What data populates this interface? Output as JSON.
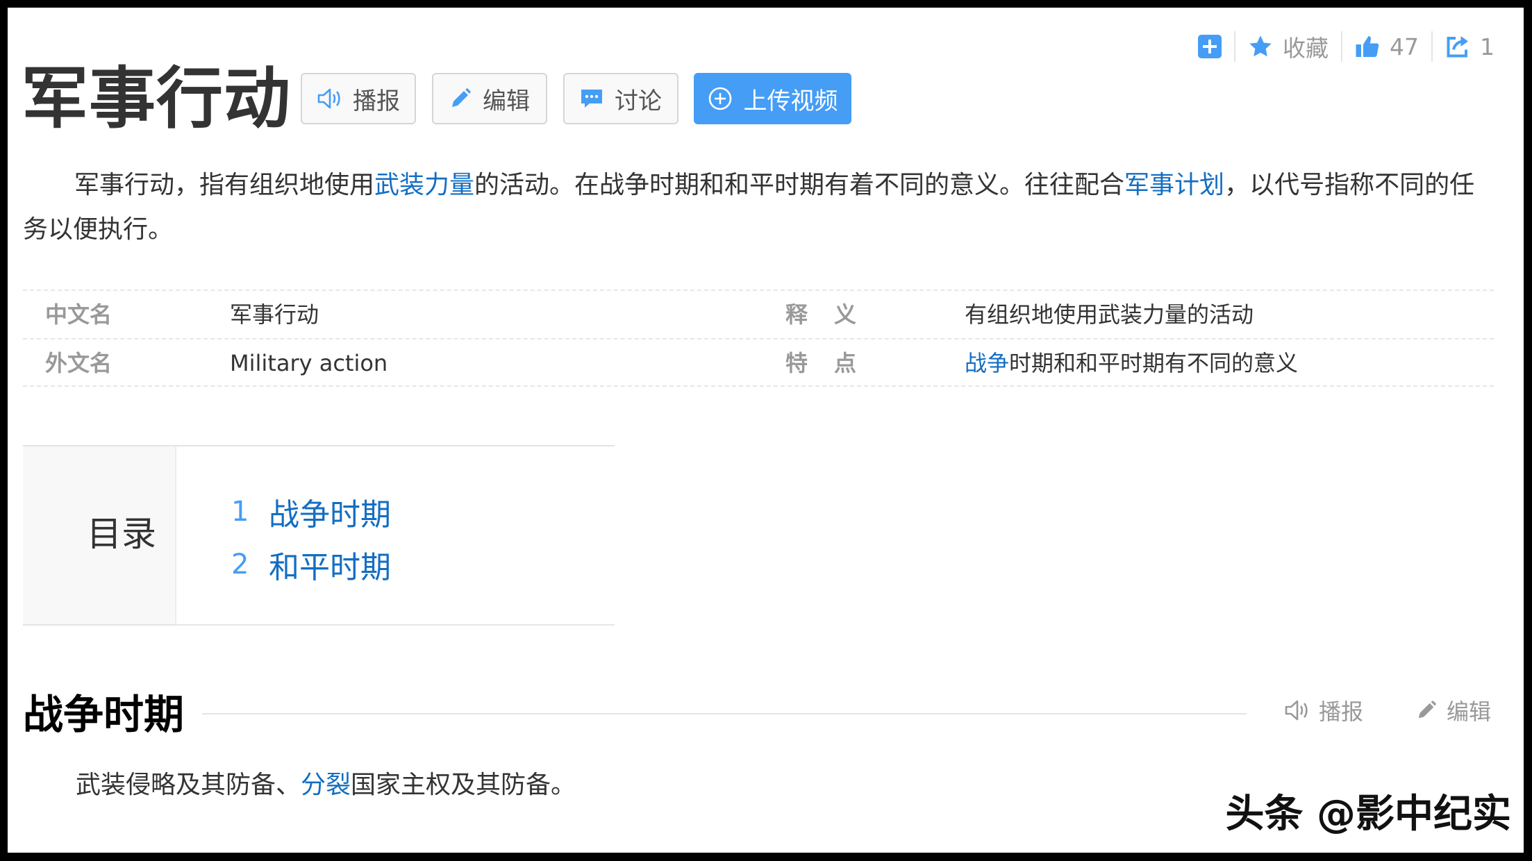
{
  "topbar": {
    "collect_label": "收藏",
    "like_count": "47",
    "share_count": "1"
  },
  "title": "军事行动",
  "buttons": {
    "play": "播报",
    "edit": "编辑",
    "discuss": "讨论",
    "upload": "上传视频"
  },
  "summary": {
    "p1": "军事行动，指有组织地使用",
    "link1": "武装力量",
    "p2": "的活动。在战争时期和和平时期有着不同的意义。往往配合",
    "link2": "军事计划",
    "p3": "，以代号指称不同的任务以便执行。"
  },
  "basic_info": [
    {
      "k1": "中文名",
      "v1": "军事行动",
      "k2": "释义",
      "v2_link": "",
      "v2": "有组织地使用武装力量的活动"
    },
    {
      "k1": "外文名",
      "v1": "Military action",
      "k2": "特点",
      "v2_link": "战争",
      "v2": "时期和和平时期有不同的意义"
    }
  ],
  "catalog": {
    "title": "目录",
    "items": [
      {
        "num": "1",
        "label": "战争时期"
      },
      {
        "num": "2",
        "label": "和平时期"
      }
    ]
  },
  "section": {
    "title": "战争时期",
    "play": "播报",
    "edit": "编辑",
    "text1": "武装侵略及其防备、",
    "link": "分裂",
    "text2": "国家主权及其防备。"
  },
  "watermark": "头条 @影中纪实",
  "colors": {
    "link": "#136ec2",
    "accent": "#459df5",
    "muted": "#999999"
  }
}
